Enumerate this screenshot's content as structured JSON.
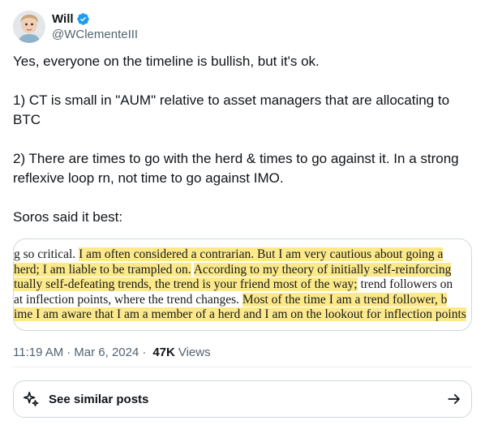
{
  "author": {
    "display_name": "Will",
    "handle": "@WClementeIII",
    "verified": true,
    "verified_color": "#1d9bf0"
  },
  "tweet": {
    "paragraphs": [
      "Yes, everyone on the timeline is bullish, but it's ok.",
      "1) CT is small in \"AUM\" relative to asset managers that are allocating to BTC",
      "2) There are times to go with the herd & times to go against it. In a strong reflexive loop rn, not time to go against IMO.",
      "Soros said it best:"
    ]
  },
  "media": {
    "highlight_color": "#fbe98a",
    "lines": [
      {
        "plain": "g so critical. ",
        "highlight": "I am often considered a contrarian. But I am very cautious about going a"
      },
      {
        "highlight": "herd; I am liable to be trampled on.",
        "plain": " ",
        "highlight2": "According to my theory of initially self-reinforcing"
      },
      {
        "highlight": "tually self-defeating trends, the trend is your friend most of the way;",
        "plain": " trend followers on"
      },
      {
        "plain": "at inflection points, where the trend changes. ",
        "highlight": "Most of the time I am a trend follower, b"
      },
      {
        "highlight": "ime I am aware that I am a member of a herd and I am on the lookout for inflection points"
      }
    ]
  },
  "meta": {
    "time": "11:19 AM",
    "separator": "·",
    "date": "Mar 6, 2024",
    "separator2": "·",
    "views_count": "47K",
    "views_label": "Views"
  },
  "similar_posts": {
    "label": "See similar posts",
    "icon": "sparkle-icon"
  }
}
